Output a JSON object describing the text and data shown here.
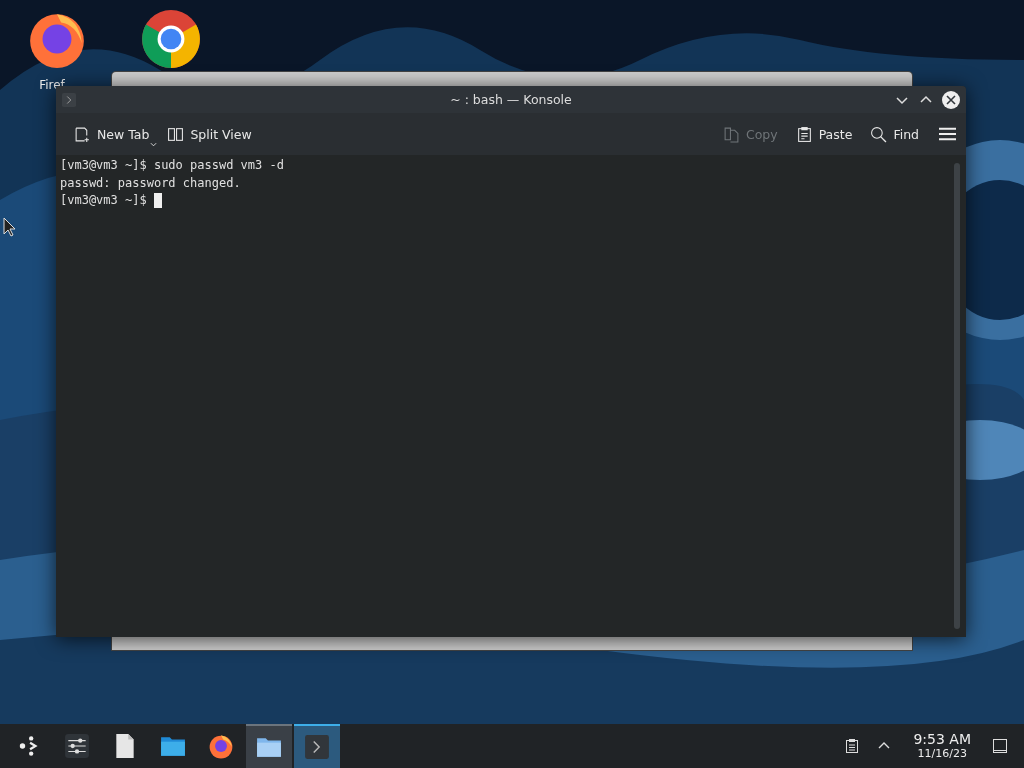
{
  "desktop_icons": [
    {
      "kind": "firefox",
      "label": "Firef"
    },
    {
      "kind": "chrome"
    }
  ],
  "window": {
    "title": "~ : bash — Konsole"
  },
  "toolbar": [
    {
      "kind": "new-tab",
      "label": "New Tab",
      "disabled": false,
      "dropdown": true
    },
    {
      "kind": "split",
      "label": "Split View",
      "disabled": false,
      "dropdown": false
    },
    {
      "kind": "copy",
      "label": "Copy",
      "disabled": true,
      "dropdown": false
    },
    {
      "kind": "paste",
      "label": "Paste",
      "disabled": false,
      "dropdown": false
    },
    {
      "kind": "find",
      "label": "Find",
      "disabled": false,
      "dropdown": false
    }
  ],
  "terminal": {
    "lines": [
      "[vm3@vm3 ~]$ sudo passwd vm3 -d",
      "passwd: password changed.",
      "[vm3@vm3 ~]$ "
    ],
    "cursor": true
  },
  "taskbar": {
    "items": [
      {
        "kind": "launcher",
        "open": false,
        "selected": false
      },
      {
        "kind": "settings",
        "open": false,
        "selected": false
      },
      {
        "kind": "document",
        "open": false,
        "selected": false
      },
      {
        "kind": "folder",
        "open": false,
        "selected": false
      },
      {
        "kind": "firefox",
        "open": false,
        "selected": false
      },
      {
        "kind": "folder",
        "open": true,
        "selected": false
      },
      {
        "kind": "terminal",
        "open": true,
        "selected": true
      }
    ],
    "time": "9:53 AM",
    "date": "11/16/23"
  }
}
